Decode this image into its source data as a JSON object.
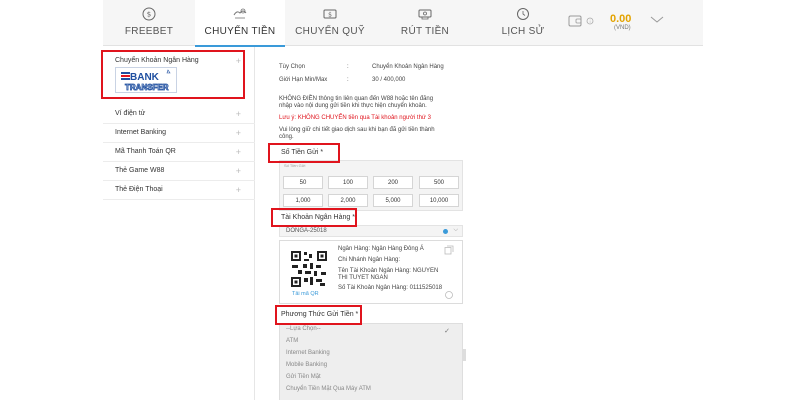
{
  "nav": {
    "tabs": [
      {
        "label": "FREEBET",
        "icon": "gift-coin-icon"
      },
      {
        "label": "CHUYỂN TIỀN",
        "icon": "money-transfer-icon"
      },
      {
        "label": "CHUYỂN QUỸ",
        "icon": "fund-transfer-icon"
      },
      {
        "label": "RÚT TIỀN",
        "icon": "withdraw-icon"
      },
      {
        "label": "LỊCH SỬ",
        "icon": "history-clock-icon"
      }
    ],
    "active_tab": "CHUYỂN TIỀN",
    "wallet": {
      "amount": "0.00",
      "currency": "(VND)",
      "icon": "wallet-icon"
    }
  },
  "sidebar": {
    "selected": {
      "label": "Chuyển Khoản Ngân Hàng",
      "logo_top": "BANK",
      "logo_bottom": "TRANSFER"
    },
    "items": [
      {
        "label": "Ví điện tử"
      },
      {
        "label": "Internet Banking"
      },
      {
        "label": "Mã Thanh Toán QR"
      },
      {
        "label": "Thẻ Game W88"
      },
      {
        "label": "Thẻ Điện Thoại"
      }
    ]
  },
  "main": {
    "option_key": "Tùy Chọn",
    "option_colon": ":",
    "option_value": "Chuyển Khoản Ngân Hàng",
    "limit_key": "Giới Hạn Min/Max",
    "limit_colon": ":",
    "limit_value": "30 / 400,000",
    "notice_line1": "KHÔNG ĐIỀN thông tin liên quan đến W88 hoặc tên đăng",
    "notice_line2": "nhập vào nội dung gửi tiền khi thực hiện chuyển khoản.",
    "warning": "Lưu ý: KHÔNG CHUYỂN tiền qua Tài khoản người thứ 3",
    "keep_line1": "Vui lòng giữ chi tiết giao dịch sau khi bạn đã gửi tiền thành",
    "keep_line2": "công.",
    "amount_label": "Số Tiền Gửi *",
    "amount_hint": "Số Tiền Gửi",
    "amounts": [
      "50",
      "100",
      "200",
      "500",
      "1,000",
      "2,000",
      "5,000",
      "10,000"
    ],
    "account_label": "Tài Khoản Ngân Hàng *",
    "account_value": "DONGA-25018",
    "bank_card": {
      "bank_name": "Ngân Hàng: Ngân Hàng Đông Á",
      "branch": "Chi Nhánh Ngân Hàng:",
      "holder_line1": "Tên Tài Khoản Ngân Hàng: NGUYEN",
      "holder_line2": "THI TUYET NGAN",
      "account_no": "Số Tài Khoản Ngân Hàng: 0111525018",
      "qr_label": "Tải mã QR"
    },
    "method_label": "Phương Thức Gửi Tiền *",
    "methods": [
      "--Lựa Chọn--",
      "ATM",
      "Internet Banking",
      "Mobile Banking",
      "Gửi Tiền Mặt",
      "Chuyển Tiền Mặt Qua Máy ATM"
    ],
    "method_check": "✓"
  },
  "colors": {
    "highlight": "#e0141d",
    "accent": "#3a9ad9",
    "wallet": "#e3a300",
    "bank_logo_red": "#e0141d",
    "bank_logo_blue": "#1f4fa0"
  }
}
